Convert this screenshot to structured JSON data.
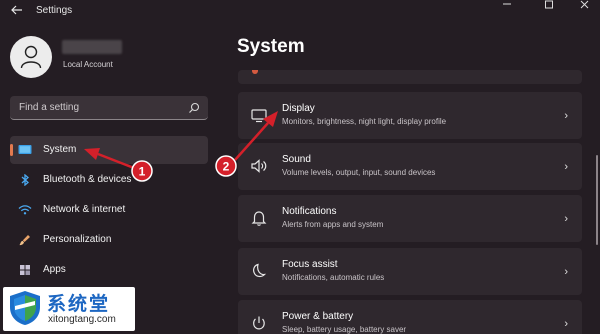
{
  "window": {
    "title": "Settings",
    "back_icon": "back-arrow-icon",
    "controls": [
      "minimize-icon",
      "maximize-icon",
      "close-icon"
    ]
  },
  "account": {
    "type": "Local Account"
  },
  "search": {
    "placeholder": "Find a setting"
  },
  "sidebar": {
    "items": [
      {
        "label": "System",
        "icon": "display-icon",
        "active": true
      },
      {
        "label": "Bluetooth & devices",
        "icon": "bluetooth-icon"
      },
      {
        "label": "Network & internet",
        "icon": "wifi-icon"
      },
      {
        "label": "Personalization",
        "icon": "paintbrush-icon"
      },
      {
        "label": "Apps",
        "icon": "apps-icon"
      }
    ]
  },
  "main": {
    "title": "System",
    "cards": [
      {
        "title": "Display",
        "subtitle": "Monitors, brightness, night light, display profile",
        "icon": "monitor-icon"
      },
      {
        "title": "Sound",
        "subtitle": "Volume levels, output, input, sound devices",
        "icon": "speaker-icon"
      },
      {
        "title": "Notifications",
        "subtitle": "Alerts from apps and system",
        "icon": "bell-icon"
      },
      {
        "title": "Focus assist",
        "subtitle": "Notifications, automatic rules",
        "icon": "moon-icon"
      },
      {
        "title": "Power & battery",
        "subtitle": "Sleep, battery usage, battery saver",
        "icon": "power-icon"
      }
    ]
  },
  "annotations": [
    {
      "number": "1",
      "color": "#d4202a"
    },
    {
      "number": "2",
      "color": "#d4202a"
    }
  ],
  "watermark": {
    "text": "系统堂",
    "url": "xitongtang.com"
  },
  "colors": {
    "accent": "#e37a4f",
    "background": "#241d23",
    "card": "#2f282e"
  }
}
